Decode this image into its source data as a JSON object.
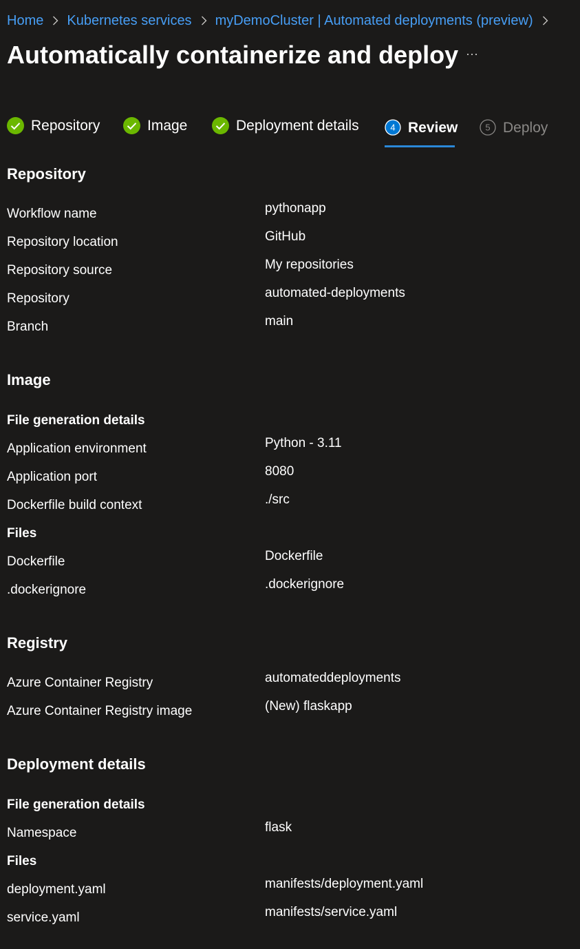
{
  "breadcrumb": {
    "items": [
      "Home",
      "Kubernetes services",
      "myDemoCluster | Automated deployments (preview)"
    ]
  },
  "page": {
    "title": "Automatically containerize and deploy",
    "more_label": "···"
  },
  "steps": [
    {
      "label": "Repository",
      "status": "complete"
    },
    {
      "label": "Image",
      "status": "complete"
    },
    {
      "label": "Deployment details",
      "status": "complete"
    },
    {
      "label": "Review",
      "status": "active",
      "number": "4"
    },
    {
      "label": "Deploy",
      "status": "disabled",
      "number": "5"
    }
  ],
  "sections": {
    "repository": {
      "heading": "Repository",
      "rows": [
        {
          "label": "Workflow name",
          "value": "pythonapp"
        },
        {
          "label": "Repository location",
          "value": "GitHub"
        },
        {
          "label": "Repository source",
          "value": "My repositories"
        },
        {
          "label": "Repository",
          "value": "automated-deployments"
        },
        {
          "label": "Branch",
          "value": "main"
        }
      ]
    },
    "image": {
      "heading": "Image",
      "file_generation_heading": "File generation details",
      "generation_rows": [
        {
          "label": "Application environment",
          "value": "Python - 3.11"
        },
        {
          "label": "Application port",
          "value": "8080"
        },
        {
          "label": "Dockerfile build context",
          "value": "./src"
        }
      ],
      "files_heading": "Files",
      "file_rows": [
        {
          "label": "Dockerfile",
          "value": "Dockerfile"
        },
        {
          "label": ".dockerignore",
          "value": ".dockerignore"
        }
      ]
    },
    "registry": {
      "heading": "Registry",
      "rows": [
        {
          "label": "Azure Container Registry",
          "value": "automateddeployments"
        },
        {
          "label": "Azure Container Registry image",
          "value": "(New) flaskapp"
        }
      ]
    },
    "deployment": {
      "heading": "Deployment details",
      "file_generation_heading": "File generation details",
      "generation_rows": [
        {
          "label": "Namespace",
          "value": "flask"
        }
      ],
      "files_heading": "Files",
      "file_rows": [
        {
          "label": "deployment.yaml",
          "value": "manifests/deployment.yaml"
        },
        {
          "label": "service.yaml",
          "value": "manifests/service.yaml"
        }
      ]
    }
  },
  "colors": {
    "background": "#1b1a19",
    "link": "#479ef5",
    "success": "#6bb700",
    "accent": "#2b88d8",
    "disabled": "#8a8886"
  },
  "icons": {
    "breadcrumb_separator": "chevron-right-icon",
    "complete_step": "checkmark-circle-icon",
    "more": "more-icon"
  }
}
